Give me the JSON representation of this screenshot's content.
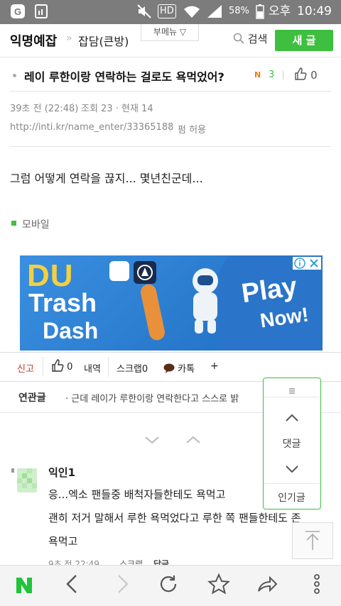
{
  "status_bar": {
    "battery": "58%",
    "ampm": "오후",
    "time": "10:49",
    "hd": "HD"
  },
  "header": {
    "board_title": "익명예잡",
    "separator": "»",
    "sub_board": "잡담(큰방)",
    "submenu_label": "부메뉴 ▽",
    "search_label": "검색",
    "new_post_label": "새 글"
  },
  "post": {
    "title": "레이 루한이랑 연락하는 걸로도 욕먹었어?",
    "comment_count": "3",
    "likes": "0",
    "time": "39초 전 (22:48)",
    "views": "조회 23 · 현재 14",
    "url": "http://inti.kr/name_enter/33365188",
    "share": "펌 허용",
    "content": "그럼 어떻게 연락을 끊지... 몇년친군데...",
    "device": "모바일"
  },
  "ad": {
    "line1": "DU",
    "line2": "Trash",
    "line3": "Dash",
    "cta1": "Play",
    "cta2": "Now!"
  },
  "actions": {
    "report": "신고",
    "likes": "0",
    "history": "내역",
    "scrap": "스크랩0",
    "kakao": "카톡",
    "more": "+"
  },
  "related": {
    "label": "연관글",
    "item": "근데 레이가 루한이랑 연락한다고 스스로 밝"
  },
  "float_panel": {
    "comments_label": "댓글",
    "popular_label": "인기글"
  },
  "comment": {
    "author": "익인1",
    "lines": [
      "응...엑소 팬들중 배척자들한테도 욕먹고",
      "괜히 저거 말해서 루한 욕먹었다고 루한 쪽 팬들한테도 존",
      "욕먹고"
    ],
    "meta": "9초 전 22:49",
    "scrap": "스크랩",
    "reply": "답글"
  },
  "colors": {
    "accent": "#3fbf3f",
    "report": "#c0392b",
    "status_bg": "#7c7c7c"
  },
  "icons": [
    "signal-g-icon",
    "gallery-icon",
    "mute-icon",
    "wifi-icon",
    "cell-signal-icon",
    "battery-icon",
    "search-icon",
    "thumbs-up-icon",
    "speech-bubble-icon",
    "menu-lines-icon",
    "chevron-up-icon",
    "chevron-down-icon",
    "arrow-top-icon",
    "naver-n-icon",
    "back-icon",
    "forward-icon",
    "refresh-icon",
    "star-icon",
    "share-icon",
    "more-vertical-icon"
  ]
}
